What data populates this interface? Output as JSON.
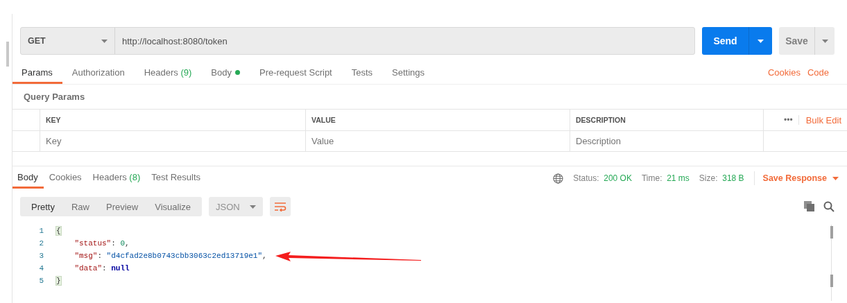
{
  "request": {
    "method": "GET",
    "url": "http://localhost:8080/token",
    "send": "Send",
    "save": "Save"
  },
  "request_tabs": [
    {
      "label": "Params",
      "selected": true
    },
    {
      "label": "Authorization",
      "selected": false
    },
    {
      "label": "Headers",
      "badge": "(9)",
      "selected": false
    },
    {
      "label": "Body",
      "dot": true,
      "selected": false
    },
    {
      "label": "Pre-request Script",
      "selected": false
    },
    {
      "label": "Tests",
      "selected": false
    },
    {
      "label": "Settings",
      "selected": false
    }
  ],
  "request_links": [
    "Cookies",
    "Code"
  ],
  "query_params": {
    "title": "Query Params",
    "columns": [
      "KEY",
      "VALUE",
      "DESCRIPTION"
    ],
    "more": "•••",
    "bulk_edit": "Bulk Edit",
    "placeholders": [
      "Key",
      "Value",
      "Description"
    ]
  },
  "response_tabs": [
    {
      "label": "Body",
      "selected": true
    },
    {
      "label": "Cookies",
      "selected": false
    },
    {
      "label": "Headers",
      "badge": "(8)",
      "selected": false
    },
    {
      "label": "Test Results",
      "selected": false
    }
  ],
  "response_status": [
    {
      "label": "Status:",
      "value": "200 OK"
    },
    {
      "label": "Time:",
      "value": "21 ms"
    },
    {
      "label": "Size:",
      "value": "318 B"
    }
  ],
  "save_response": "Save Response",
  "view_modes": [
    {
      "label": "Pretty",
      "selected": true
    },
    {
      "label": "Raw",
      "selected": false
    },
    {
      "label": "Preview",
      "selected": false
    },
    {
      "label": "Visualize",
      "selected": false
    }
  ],
  "format": "JSON",
  "code_lines": [
    {
      "number": "1",
      "tokens": [
        {
          "kind": "brace",
          "text": "{"
        }
      ]
    },
    {
      "number": "2",
      "indented": true,
      "tokens": [
        {
          "kind": "key",
          "text": "\"status\""
        },
        {
          "kind": "punct",
          "text": ": "
        },
        {
          "kind": "number",
          "text": "0"
        },
        {
          "kind": "punct",
          "text": ","
        }
      ]
    },
    {
      "number": "3",
      "indented": true,
      "tokens": [
        {
          "kind": "key",
          "text": "\"msg\""
        },
        {
          "kind": "punct",
          "text": ": "
        },
        {
          "kind": "string",
          "text": "\"d4cfad2e8b0743cbb3063c2ed13719e1\""
        },
        {
          "kind": "punct",
          "text": ","
        }
      ]
    },
    {
      "number": "4",
      "indented": true,
      "tokens": [
        {
          "kind": "key",
          "text": "\"data\""
        },
        {
          "kind": "punct",
          "text": ": "
        },
        {
          "kind": "null",
          "text": "null"
        }
      ]
    },
    {
      "number": "5",
      "tokens": [
        {
          "kind": "brace",
          "text": "}"
        }
      ]
    }
  ]
}
